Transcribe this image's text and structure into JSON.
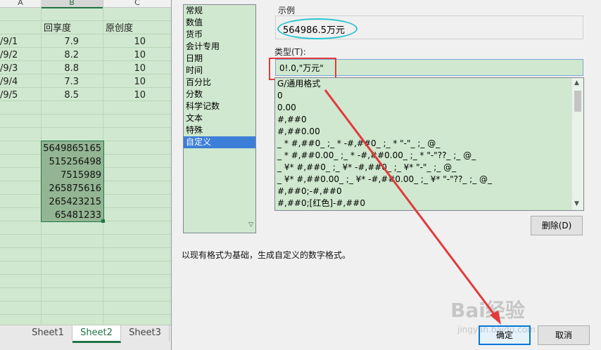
{
  "sheet": {
    "columns": [
      "A",
      "B",
      "C"
    ],
    "headers": [
      "回享度",
      "原创度"
    ],
    "rows": [
      {
        "date": "/9/1",
        "b": "7.9",
        "c": "10"
      },
      {
        "date": "/9/2",
        "b": "8.2",
        "c": "10"
      },
      {
        "date": "/9/3",
        "b": "8.8",
        "c": "10"
      },
      {
        "date": "/9/4",
        "b": "7.3",
        "c": "10"
      },
      {
        "date": "/9/5",
        "b": "8.5",
        "c": "10"
      }
    ],
    "selected_values": [
      "5649865165",
      "515256498",
      "7515989",
      "265875616",
      "265423215",
      "65481233"
    ],
    "tabs": [
      "Sheet1",
      "Sheet2",
      "Sheet3"
    ],
    "active_tab": "Sheet2"
  },
  "dialog": {
    "categories": [
      "常规",
      "数值",
      "货币",
      "会计专用",
      "日期",
      "时间",
      "百分比",
      "分数",
      "科学记数",
      "文本",
      "特殊",
      "自定义"
    ],
    "selected_category": "自定义",
    "sample_label": "示例",
    "sample_value": "564986.5万元",
    "type_label": "类型(T):",
    "type_value": "0!.0,\"万元\"",
    "formats": [
      "G/通用格式",
      "0",
      "0.00",
      "#,##0",
      "#,##0.00",
      "_ * #,##0_ ;_ * -#,##0_ ;_ * \"-\"_ ;_ @_",
      "_ * #,##0.00_ ;_ * -#,##0.00_ ;_ * \"-\"??_ ;_ @_",
      "_ ¥* #,##0_ ;_ ¥* -#,##0_ ;_ ¥* \"-\"_ ;_ @_",
      "_ ¥* #,##0.00_ ;_ ¥* -#,##0.00_ ;_ ¥* \"-\"??_ ;_ @_",
      "#,##0;-#,##0",
      "#,##0;[红色]-#,##0"
    ],
    "delete_label": "删除(D)",
    "description": "以现有格式为基础，生成自定义的数字格式。",
    "ok_label": "确定",
    "cancel_label": "取消"
  },
  "colors": {
    "accent": "#217346",
    "highlight_red": "#e23a3a",
    "oval_cyan": "#2dc3cf",
    "cell_bg": "#cfe8cf"
  },
  "watermark": "Bai经验",
  "watermark_sub": "jingyan.baidu.com"
}
